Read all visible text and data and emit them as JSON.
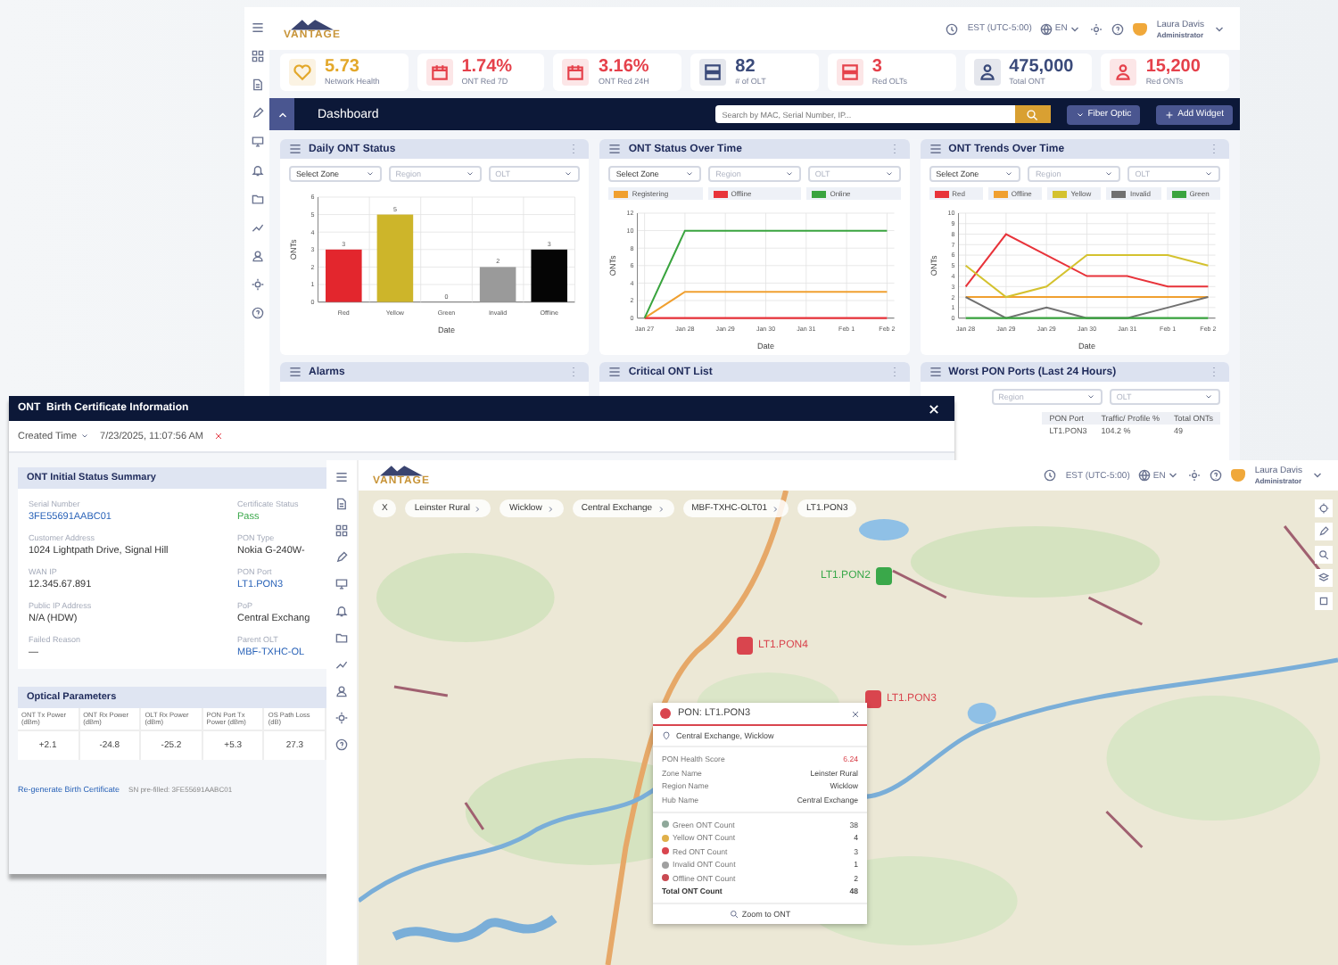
{
  "dashboard_window": {
    "logo": "VANTAGE",
    "timezone": "EST (UTC-5:00)",
    "language": "EN",
    "user": {
      "name": "Laura Davis",
      "role": "Administrator"
    },
    "kpis": [
      {
        "value": "5.73",
        "label": "Network Health",
        "color": "#e3a82b"
      },
      {
        "value": "1.74%",
        "label": "ONT Red 7D",
        "color": "#e5414b"
      },
      {
        "value": "3.16%",
        "label": "ONT Red 24H",
        "color": "#e5414b"
      },
      {
        "value": "82",
        "label": "# of OLT",
        "color": "#3a4a7a"
      },
      {
        "value": "3",
        "label": "Red OLTs",
        "color": "#e5414b"
      },
      {
        "value": "475,000",
        "label": "Total ONT",
        "color": "#3a4a7a"
      },
      {
        "value": "15,200",
        "label": "Red ONTs",
        "color": "#e5414b"
      }
    ],
    "toolbar": {
      "title": "Dashboard",
      "search": {
        "placeholder": "Search by MAC, Serial Number, IP..."
      },
      "buttons": [
        {
          "label": "Fiber Optic",
          "kind": "dropdown"
        },
        {
          "label": "Add Widget",
          "kind": "add"
        }
      ]
    },
    "widgets": [
      {
        "title": "Daily ONT Status",
        "filters": [
          {
            "text": "Select Zone",
            "kind": "value"
          },
          {
            "text": "Region",
            "kind": "placeholder"
          },
          {
            "text": "OLT",
            "kind": "placeholder"
          }
        ],
        "chart_data": {
          "type": "bar",
          "xlabel": "Date",
          "ylabel": "ONTs",
          "categories": [
            "Red",
            "Yellow",
            "Green",
            "Invalid",
            "Offline"
          ],
          "colors": [
            "#e3262d",
            "#cdb52a",
            "#35a84a",
            "#9a9a9a",
            "#050505"
          ],
          "values": [
            3,
            5,
            0,
            2,
            3
          ],
          "grid": true,
          "ylim": [
            0,
            6
          ],
          "yticks": [
            0,
            1,
            2,
            3,
            4,
            5,
            6
          ],
          "data_labels": true
        }
      },
      {
        "title": "ONT Status Over Time",
        "filters": [
          {
            "text": "Select Zone",
            "kind": "value"
          },
          {
            "text": "Region",
            "kind": "placeholder"
          },
          {
            "text": "OLT",
            "kind": "placeholder"
          }
        ],
        "chart_data": {
          "type": "line",
          "xlabel": "Date",
          "ylabel": "ONTs",
          "x": [
            "Jan 27",
            "Jan 28",
            "Jan 29",
            "Jan 30",
            "Jan 31",
            "Feb 1",
            "Feb 2"
          ],
          "grid": true,
          "ylim": [
            0,
            12
          ],
          "yticks": [
            0,
            2,
            4,
            6,
            8,
            10,
            12
          ],
          "series": [
            {
              "name": "Registering",
              "color": "#f0a030",
              "values": [
                0,
                3,
                3,
                3,
                3,
                3,
                3
              ]
            },
            {
              "name": "Offline",
              "color": "#e8333a",
              "values": [
                0,
                0,
                0,
                0,
                0,
                0,
                0
              ]
            },
            {
              "name": "Online",
              "color": "#3aa43f",
              "values": [
                0,
                10,
                10,
                10,
                10,
                10,
                10
              ]
            }
          ]
        }
      },
      {
        "title": "ONT Trends Over Time",
        "filters": [
          {
            "text": "Select Zone",
            "kind": "value"
          },
          {
            "text": "Region",
            "kind": "placeholder"
          },
          {
            "text": "OLT",
            "kind": "placeholder"
          }
        ],
        "chart_data": {
          "type": "line",
          "xlabel": "Date",
          "ylabel": "ONTs",
          "x": [
            "Jan 28",
            "Jan 29",
            "Jan 29",
            "Jan 30",
            "Jan 31",
            "Feb 1",
            "Feb 2"
          ],
          "grid": true,
          "ylim": [
            0,
            10
          ],
          "yticks": [
            0,
            1,
            2,
            3,
            4,
            5,
            6,
            7,
            8,
            9,
            10
          ],
          "series": [
            {
              "name": "Red",
              "color": "#e8333a",
              "values": [
                3,
                8,
                6,
                4,
                4,
                3,
                3
              ]
            },
            {
              "name": "Offline",
              "color": "#f0a030",
              "values": [
                2,
                2,
                2,
                2,
                2,
                2,
                2
              ]
            },
            {
              "name": "Yellow",
              "color": "#d4c22f",
              "values": [
                5,
                2,
                3,
                6,
                6,
                6,
                5
              ]
            },
            {
              "name": "Invalid",
              "color": "#707070",
              "values": [
                2,
                0,
                1,
                0,
                0,
                1,
                2
              ]
            },
            {
              "name": "Green",
              "color": "#3aa43f",
              "values": [
                0,
                0,
                0,
                0,
                0,
                0,
                0
              ]
            }
          ]
        }
      }
    ],
    "widgets_row2": [
      {
        "title": "Alarms"
      },
      {
        "title": "Critical ONT List"
      },
      {
        "title": "Worst PON Ports (Last 24 Hours)",
        "filters": [
          {
            "text": "Region",
            "kind": "placeholder"
          },
          {
            "text": "OLT",
            "kind": "placeholder"
          }
        ],
        "table": {
          "columns": [
            "PON Port",
            "Traffic/ Profile %",
            "Total ONTs"
          ],
          "rows": [
            [
              "LT1.PON3",
              "104.2 %",
              "49"
            ]
          ]
        }
      }
    ]
  },
  "certificate_window": {
    "title": "ONT  Birth Certificate Information",
    "filter": {
      "label": "Created Time",
      "value": "7/23/2025, 11:07:56 AM"
    },
    "summary": {
      "title": "ONT Initial Status Summary",
      "fields": [
        {
          "label": "Serial Number",
          "value": "3FE55691AABC01",
          "kind": "link"
        },
        {
          "label": "Certificate Status",
          "value": "Pass",
          "kind": "pass"
        },
        {
          "label": "Customer Address",
          "value": "1024 Lightpath Drive, Signal Hill",
          "kind": "text"
        },
        {
          "label": "PON Type",
          "value": "Nokia G-240W-",
          "kind": "text"
        },
        {
          "label": "WAN IP",
          "value": "12.345.67.891",
          "kind": "text"
        },
        {
          "label": "PON Port",
          "value": "LT1.PON3",
          "kind": "link"
        },
        {
          "label": "Public IP Address",
          "value": "N/A (HDW)",
          "kind": "text"
        },
        {
          "label": "PoP",
          "value": "Central Exchang",
          "kind": "text"
        },
        {
          "label": "Failed Reason",
          "value": "—",
          "kind": "text"
        },
        {
          "label": "Parent OLT",
          "value": "MBF-TXHC-OL",
          "kind": "link"
        }
      ]
    },
    "optical": {
      "title": "Optical Parameters",
      "columns": [
        "ONT Tx Power (dBm)",
        "ONT Rx Power (dBm)",
        "OLT Rx Power (dBm)",
        "PON Port Tx Power (dBm)",
        "OS Path Loss (dB)"
      ],
      "values": [
        "+2.1",
        "-24.8",
        "-25.2",
        "+5.3",
        "27.3"
      ]
    },
    "footer": {
      "link": "Re-generate Birth Certificate",
      "note": "SN pre-filled: 3FE55691AABC01"
    }
  },
  "map_window": {
    "logo": "VANTAGE",
    "timezone": "EST (UTC-5:00)",
    "language": "EN",
    "user": {
      "name": "Laura Davis",
      "role": "Administrator"
    },
    "clear_chip": "X",
    "breadcrumbs": [
      "Leinster Rural",
      "Wicklow",
      "Central Exchange",
      "MBF-TXHC-OLT01",
      "LT1.PON3"
    ],
    "markers": [
      {
        "label": "LT1.PON2",
        "color": "#3aa84a"
      },
      {
        "label": "LT1.PON4",
        "color": "#d9454e"
      },
      {
        "label": "LT1.PON3",
        "color": "#d9454e"
      }
    ],
    "popup": {
      "title": "PON: LT1.PON3",
      "color": "#d9454e",
      "location": "Central Exchange, Wicklow",
      "details": [
        {
          "label": "PON Health Score",
          "value": "6.24",
          "kind": "score"
        },
        {
          "label": "Zone Name",
          "value": "Leinster Rural",
          "kind": "text"
        },
        {
          "label": "Region Name",
          "value": "Wicklow",
          "kind": "text"
        },
        {
          "label": "Hub Name",
          "value": "Central Exchange",
          "kind": "text"
        }
      ],
      "counts": [
        {
          "label": "Green ONT Count",
          "value": "38",
          "color": "#8fa89a"
        },
        {
          "label": "Yellow ONT Count",
          "value": "4",
          "color": "#e0b04a"
        },
        {
          "label": "Red ONT Count",
          "value": "3",
          "color": "#d9454e"
        },
        {
          "label": "Invalid ONT Count",
          "value": "1",
          "color": "#a0a0a0"
        },
        {
          "label": "Offline ONT Count",
          "value": "2",
          "color": "#c94a52"
        }
      ],
      "total": {
        "label": "Total ONT Count",
        "value": "48"
      },
      "button": "Zoom to ONT"
    }
  }
}
